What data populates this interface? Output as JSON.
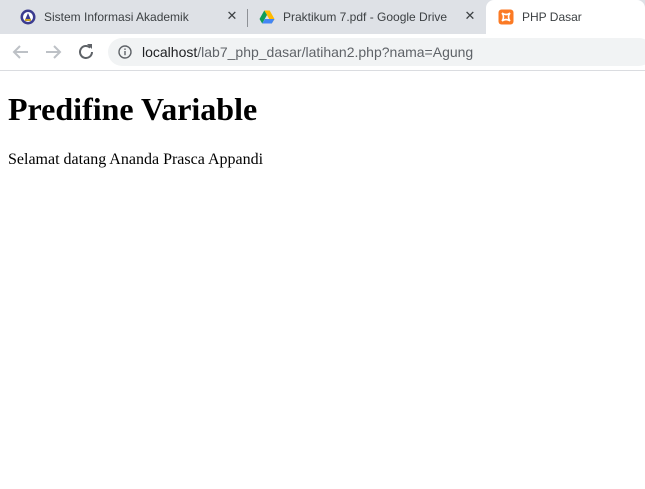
{
  "tabs": [
    {
      "title": "Sistem Informasi Akademik",
      "icon": "university-logo-icon",
      "close": "✕",
      "active": false
    },
    {
      "title": "Praktikum 7.pdf - Google Drive",
      "icon": "google-drive-icon",
      "close": "✕",
      "active": false
    },
    {
      "title": "PHP Dasar",
      "icon": "xampp-icon",
      "active": true
    }
  ],
  "toolbar": {
    "back_icon": "back-arrow-icon",
    "forward_icon": "forward-arrow-icon",
    "reload_icon": "reload-icon",
    "site_info_icon": "info-icon",
    "url_host": "localhost",
    "url_path": "/lab7_php_dasar/latihan2.php?nama=Agung"
  },
  "page": {
    "heading": "Predifine Variable",
    "text": "Selamat datang Ananda Prasca Appandi"
  },
  "colors": {
    "tab_strip": "#dee1e6",
    "active_tab": "#ffffff",
    "omnibox": "#f1f3f4",
    "xampp_orange": "#fb7a24"
  }
}
